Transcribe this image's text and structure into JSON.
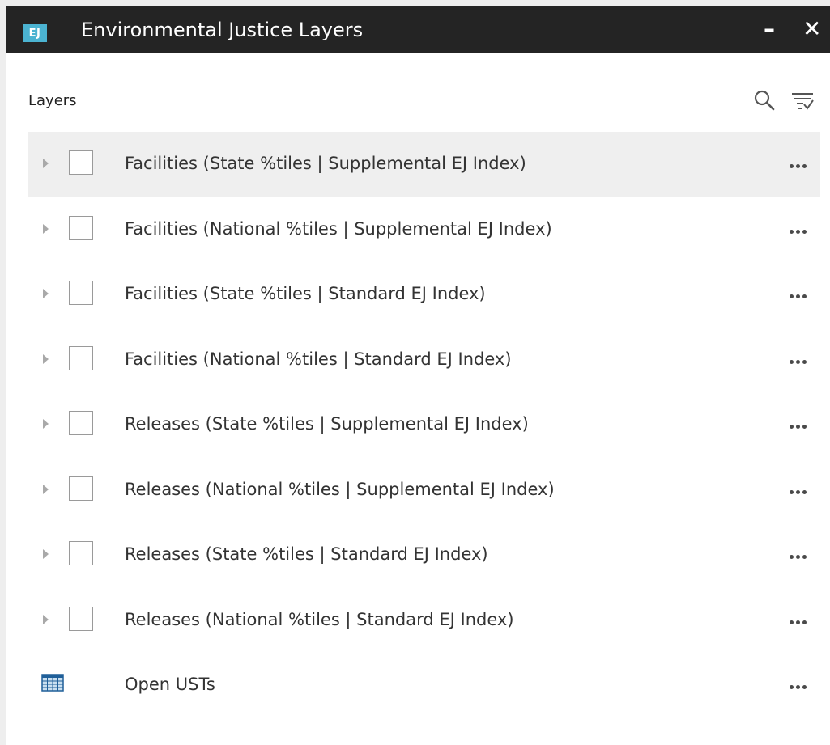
{
  "window": {
    "logo_text": "EJ",
    "title": "Environmental Justice Layers",
    "minimize": "–",
    "close": "✕"
  },
  "layers_panel": {
    "header": "Layers",
    "items": [
      {
        "label": "Facilities (State %tiles | Supplemental EJ Index)",
        "type": "group",
        "checked": false
      },
      {
        "label": "Facilities (National %tiles | Supplemental EJ Index)",
        "type": "group",
        "checked": false
      },
      {
        "label": "Facilities (State %tiles | Standard EJ Index)",
        "type": "group",
        "checked": false
      },
      {
        "label": "Facilities (National %tiles | Standard EJ Index)",
        "type": "group",
        "checked": false
      },
      {
        "label": "Releases (State %tiles | Supplemental EJ Index)",
        "type": "group",
        "checked": false
      },
      {
        "label": "Releases (National %tiles | Supplemental EJ Index)",
        "type": "group",
        "checked": false
      },
      {
        "label": "Releases (State %tiles | Standard EJ Index)",
        "type": "group",
        "checked": false
      },
      {
        "label": "Releases (National %tiles | Standard EJ Index)",
        "type": "group",
        "checked": false
      },
      {
        "label": "Open USTs",
        "type": "table"
      }
    ]
  },
  "colors": {
    "titlebar": "#242424",
    "logo": "#4bb3d1",
    "hover_row": "#efefef"
  }
}
